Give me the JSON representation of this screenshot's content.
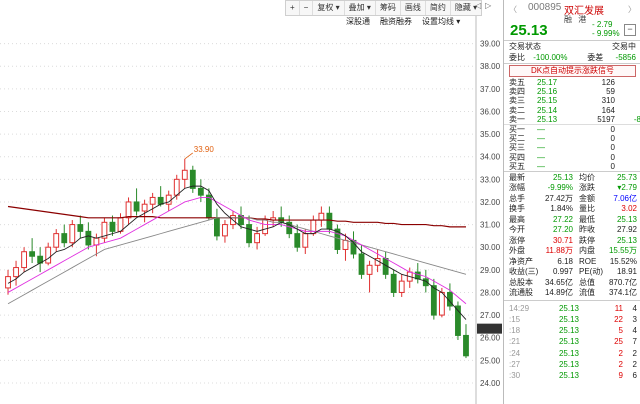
{
  "toolbar": {
    "buttons": [
      {
        "name": "zoom-in",
        "label": "+"
      },
      {
        "name": "zoom-out",
        "label": "−"
      },
      {
        "name": "restore",
        "label": "复权 ▾"
      },
      {
        "name": "overlay",
        "label": "叠加 ▾"
      },
      {
        "name": "chips",
        "label": "筹码"
      },
      {
        "name": "draw",
        "label": "画线"
      },
      {
        "name": "brief",
        "label": "简约"
      },
      {
        "name": "hide",
        "label": "隐藏 ▾"
      }
    ],
    "row2": [
      "深股通",
      "融资融券",
      "设置均线 ▾"
    ],
    "win_controls": [
      "◁",
      "▷"
    ]
  },
  "chart": {
    "price_ticks": [
      "39.00",
      "38.00",
      "37.00",
      "36.00",
      "35.00",
      "34.00",
      "33.00",
      "32.00",
      "31.00",
      "30.00",
      "29.00",
      "28.00",
      "27.00",
      "26.40",
      "26.00",
      "25.00",
      "24.00"
    ],
    "high_annotation": "33.90",
    "current_tag": "26.40"
  },
  "colors": {
    "up": "#e03030",
    "down": "#2a8a2a",
    "ma5": "#222222",
    "ma10": "#e030e0",
    "ma20": "#888888",
    "ma60": "#8b0000"
  },
  "chart_data": {
    "type": "candlestick",
    "ylim": [
      23.6,
      39.6
    ],
    "ohlc": [
      [
        28.2,
        29.0,
        27.9,
        28.7
      ],
      [
        28.7,
        29.4,
        28.3,
        29.1
      ],
      [
        29.1,
        30.0,
        28.9,
        29.8
      ],
      [
        29.8,
        30.4,
        29.3,
        29.6
      ],
      [
        29.6,
        30.0,
        28.9,
        29.3
      ],
      [
        29.3,
        30.2,
        29.2,
        30.0
      ],
      [
        30.0,
        30.8,
        29.8,
        30.6
      ],
      [
        30.6,
        31.0,
        30.0,
        30.2
      ],
      [
        30.2,
        31.2,
        30.0,
        31.0
      ],
      [
        31.0,
        31.4,
        30.4,
        30.7
      ],
      [
        30.7,
        31.1,
        29.9,
        30.1
      ],
      [
        30.1,
        30.6,
        29.6,
        30.4
      ],
      [
        30.4,
        31.3,
        30.2,
        31.1
      ],
      [
        31.1,
        31.4,
        30.5,
        30.7
      ],
      [
        30.7,
        31.5,
        30.6,
        31.3
      ],
      [
        31.3,
        32.2,
        31.0,
        32.0
      ],
      [
        32.0,
        32.6,
        31.4,
        31.6
      ],
      [
        31.6,
        32.1,
        31.1,
        31.9
      ],
      [
        31.9,
        32.4,
        31.5,
        32.2
      ],
      [
        32.2,
        32.7,
        31.8,
        31.9
      ],
      [
        31.9,
        32.5,
        31.6,
        32.3
      ],
      [
        32.3,
        33.2,
        32.1,
        33.0
      ],
      [
        33.0,
        33.9,
        32.6,
        33.4
      ],
      [
        33.4,
        33.6,
        32.4,
        32.6
      ],
      [
        32.6,
        33.0,
        32.0,
        32.3
      ],
      [
        32.3,
        32.6,
        31.2,
        31.3
      ],
      [
        31.3,
        31.7,
        30.3,
        30.5
      ],
      [
        30.5,
        31.2,
        30.2,
        31.0
      ],
      [
        31.0,
        31.6,
        30.8,
        31.4
      ],
      [
        31.4,
        31.8,
        30.8,
        31.0
      ],
      [
        31.0,
        31.4,
        30.0,
        30.2
      ],
      [
        30.2,
        30.9,
        29.9,
        30.6
      ],
      [
        30.6,
        31.4,
        30.5,
        31.2
      ],
      [
        31.2,
        31.6,
        30.9,
        31.3
      ],
      [
        31.3,
        31.8,
        30.9,
        31.1
      ],
      [
        31.1,
        31.4,
        30.4,
        30.6
      ],
      [
        30.6,
        31.0,
        29.8,
        30.0
      ],
      [
        30.0,
        30.8,
        29.7,
        30.6
      ],
      [
        30.6,
        31.4,
        30.5,
        31.2
      ],
      [
        31.2,
        31.8,
        30.9,
        31.5
      ],
      [
        31.5,
        31.8,
        30.6,
        30.8
      ],
      [
        30.8,
        31.0,
        29.7,
        29.9
      ],
      [
        29.9,
        30.6,
        29.4,
        30.3
      ],
      [
        30.3,
        30.7,
        29.5,
        29.7
      ],
      [
        29.7,
        30.1,
        28.6,
        28.8
      ],
      [
        28.8,
        29.4,
        28.0,
        29.2
      ],
      [
        29.2,
        29.9,
        28.9,
        29.5
      ],
      [
        29.5,
        29.8,
        28.6,
        28.8
      ],
      [
        28.8,
        29.0,
        27.8,
        28.0
      ],
      [
        28.0,
        28.8,
        27.8,
        28.5
      ],
      [
        28.5,
        29.1,
        28.2,
        28.9
      ],
      [
        28.9,
        29.3,
        28.4,
        28.6
      ],
      [
        28.6,
        29.0,
        28.0,
        28.3
      ],
      [
        28.3,
        28.6,
        26.8,
        27.0
      ],
      [
        27.0,
        28.2,
        26.9,
        28.0
      ],
      [
        28.0,
        28.4,
        27.2,
        27.4
      ],
      [
        27.4,
        27.6,
        25.9,
        26.1
      ],
      [
        26.1,
        26.6,
        25.1,
        25.2
      ]
    ],
    "ma5": [
      28.4,
      28.6,
      28.9,
      29.1,
      29.3,
      29.5,
      29.8,
      29.9,
      30.1,
      30.4,
      30.5,
      30.4,
      30.5,
      30.6,
      30.7,
      31.0,
      31.3,
      31.5,
      31.7,
      31.9,
      32.0,
      32.3,
      32.6,
      32.7,
      32.7,
      32.5,
      31.9,
      31.5,
      31.2,
      30.9,
      30.8,
      30.7,
      30.8,
      30.9,
      31.1,
      31.0,
      30.8,
      30.6,
      30.6,
      30.8,
      30.8,
      30.7,
      30.5,
      30.2,
      29.8,
      29.6,
      29.4,
      29.2,
      29.0,
      28.8,
      28.7,
      28.6,
      28.5,
      28.2,
      28.0,
      27.6,
      27.2,
      26.8
    ],
    "ma10": [
      28.0,
      28.2,
      28.4,
      28.6,
      28.8,
      29.0,
      29.2,
      29.4,
      29.6,
      29.8,
      30.0,
      30.1,
      30.2,
      30.3,
      30.4,
      30.6,
      30.8,
      31.0,
      31.2,
      31.4,
      31.6,
      31.8,
      32.0,
      32.1,
      32.2,
      32.2,
      32.0,
      31.8,
      31.6,
      31.4,
      31.2,
      31.1,
      31.0,
      31.0,
      31.0,
      30.9,
      30.8,
      30.7,
      30.7,
      30.7,
      30.7,
      30.6,
      30.5,
      30.3,
      30.1,
      29.9,
      29.7,
      29.5,
      29.3,
      29.1,
      28.9,
      28.8,
      28.7,
      28.5,
      28.3,
      28.1,
      27.8,
      27.5
    ],
    "ma20": [
      27.5,
      27.7,
      27.9,
      28.1,
      28.3,
      28.5,
      28.7,
      28.9,
      29.1,
      29.3,
      29.5,
      29.7,
      29.9,
      30.0,
      30.1,
      30.2,
      30.3,
      30.4,
      30.5,
      30.6,
      30.7,
      30.8,
      30.9,
      31.0,
      31.1,
      31.2,
      31.3,
      31.3,
      31.3,
      31.3,
      31.3,
      31.2,
      31.2,
      31.1,
      31.1,
      31.0,
      30.9,
      30.8,
      30.7,
      30.6,
      30.5,
      30.4,
      30.3,
      30.2,
      30.1,
      30.0,
      29.9,
      29.8,
      29.7,
      29.6,
      29.5,
      29.4,
      29.3,
      29.2,
      29.1,
      29.0,
      28.9,
      28.8
    ],
    "ma60": [
      31.8,
      31.75,
      31.7,
      31.65,
      31.6,
      31.55,
      31.5,
      31.45,
      31.4,
      31.35,
      31.3,
      31.3,
      31.3,
      31.3,
      31.3,
      31.35,
      31.35,
      31.35,
      31.35,
      31.3,
      31.3,
      31.3,
      31.3,
      31.3,
      31.3,
      31.3,
      31.3,
      31.3,
      31.3,
      31.3,
      31.3,
      31.25,
      31.25,
      31.2,
      31.2,
      31.2,
      31.2,
      31.2,
      31.2,
      31.2,
      31.2,
      31.15,
      31.15,
      31.1,
      31.1,
      31.1,
      31.1,
      31.05,
      31.05,
      31.0,
      31.0,
      31.0,
      31.0,
      30.95,
      30.95,
      30.9,
      30.9,
      30.9
    ]
  },
  "panel": {
    "nav_left": "〈",
    "nav_right": "〉",
    "code": "000895",
    "name": "双汇发展",
    "tags": "融 港",
    "price": "25.13",
    "change": "- 2.79",
    "change_pct": "- 9.99%",
    "minus_btn": "−",
    "status_label": "交易状态",
    "status_value": "交易中",
    "weibi_label": "委比",
    "weibi": "-100.00%",
    "weicha_label": "委差",
    "weicha": "-5856",
    "signal": "DK点自动提示涨跌信号",
    "sell": [
      {
        "label": "卖五",
        "price": "25.17",
        "vol": "126",
        "chg": ""
      },
      {
        "label": "卖四",
        "price": "25.16",
        "vol": "59",
        "chg": ""
      },
      {
        "label": "卖三",
        "price": "25.15",
        "vol": "310",
        "chg": ""
      },
      {
        "label": "卖二",
        "price": "25.14",
        "vol": "164",
        "chg": ""
      },
      {
        "label": "卖一",
        "price": "25.13",
        "vol": "5197",
        "chg": "-8"
      }
    ],
    "buy": [
      {
        "label": "买一",
        "price": "—",
        "vol": "0",
        "chg": ""
      },
      {
        "label": "买二",
        "price": "—",
        "vol": "0",
        "chg": ""
      },
      {
        "label": "买三",
        "price": "—",
        "vol": "0",
        "chg": ""
      },
      {
        "label": "买四",
        "price": "—",
        "vol": "0",
        "chg": ""
      },
      {
        "label": "买五",
        "price": "—",
        "vol": "0",
        "chg": ""
      }
    ],
    "quotes": [
      {
        "l1": "最新",
        "v1": "25.13",
        "c1": "grn",
        "l2": "均价",
        "v2": "25.73",
        "c2": "grn"
      },
      {
        "l1": "涨幅",
        "v1": "-9.99%",
        "c1": "grn",
        "l2": "涨跌",
        "v2": "▾2.79",
        "c2": "grn"
      },
      {
        "l1": "总手",
        "v1": "27.42万",
        "c1": "",
        "l2": "金额",
        "v2": "7.06亿",
        "c2": "blu"
      },
      {
        "l1": "换手",
        "v1": "1.84%",
        "c1": "",
        "l2": "量比",
        "v2": "3.02",
        "c2": "red"
      },
      {
        "l1": "最高",
        "v1": "27.22",
        "c1": "grn",
        "l2": "最低",
        "v2": "25.13",
        "c2": "grn"
      },
      {
        "l1": "今开",
        "v1": "27.20",
        "c1": "grn",
        "l2": "昨收",
        "v2": "27.92",
        "c2": ""
      },
      {
        "l1": "涨停",
        "v1": "30.71",
        "c1": "red",
        "l2": "跌停",
        "v2": "25.13",
        "c2": "grn"
      },
      {
        "l1": "外盘",
        "v1": "11.88万",
        "c1": "red",
        "l2": "内盘",
        "v2": "15.55万",
        "c2": "grn"
      },
      {
        "l1": "净资产",
        "v1": "6.18",
        "c1": "",
        "l2": "ROE",
        "v2": "15.52%",
        "c2": ""
      },
      {
        "l1": "收益(三)",
        "v1": "0.997",
        "c1": "",
        "l2": "PE(动)",
        "v2": "18.91",
        "c2": ""
      },
      {
        "l1": "总股本",
        "v1": "34.65亿",
        "c1": "",
        "l2": "总值",
        "v2": "870.7亿",
        "c2": ""
      },
      {
        "l1": "流通股",
        "v1": "14.89亿",
        "c1": "",
        "l2": "流值",
        "v2": "374.1亿",
        "c2": ""
      }
    ],
    "ticks": [
      {
        "t": "14:29",
        "p": "25.13",
        "v": "11",
        "n": "4"
      },
      {
        "t": ":15",
        "p": "25.13",
        "v": "22",
        "n": "3"
      },
      {
        "t": ":18",
        "p": "25.13",
        "v": "5",
        "n": "4"
      },
      {
        "t": ":21",
        "p": "25.13",
        "v": "25",
        "n": "7"
      },
      {
        "t": ":24",
        "p": "25.13",
        "v": "2",
        "n": "2"
      },
      {
        "t": ":27",
        "p": "25.13",
        "v": "2",
        "n": "2"
      },
      {
        "t": ":30",
        "p": "25.13",
        "v": "9",
        "n": "6"
      }
    ]
  }
}
